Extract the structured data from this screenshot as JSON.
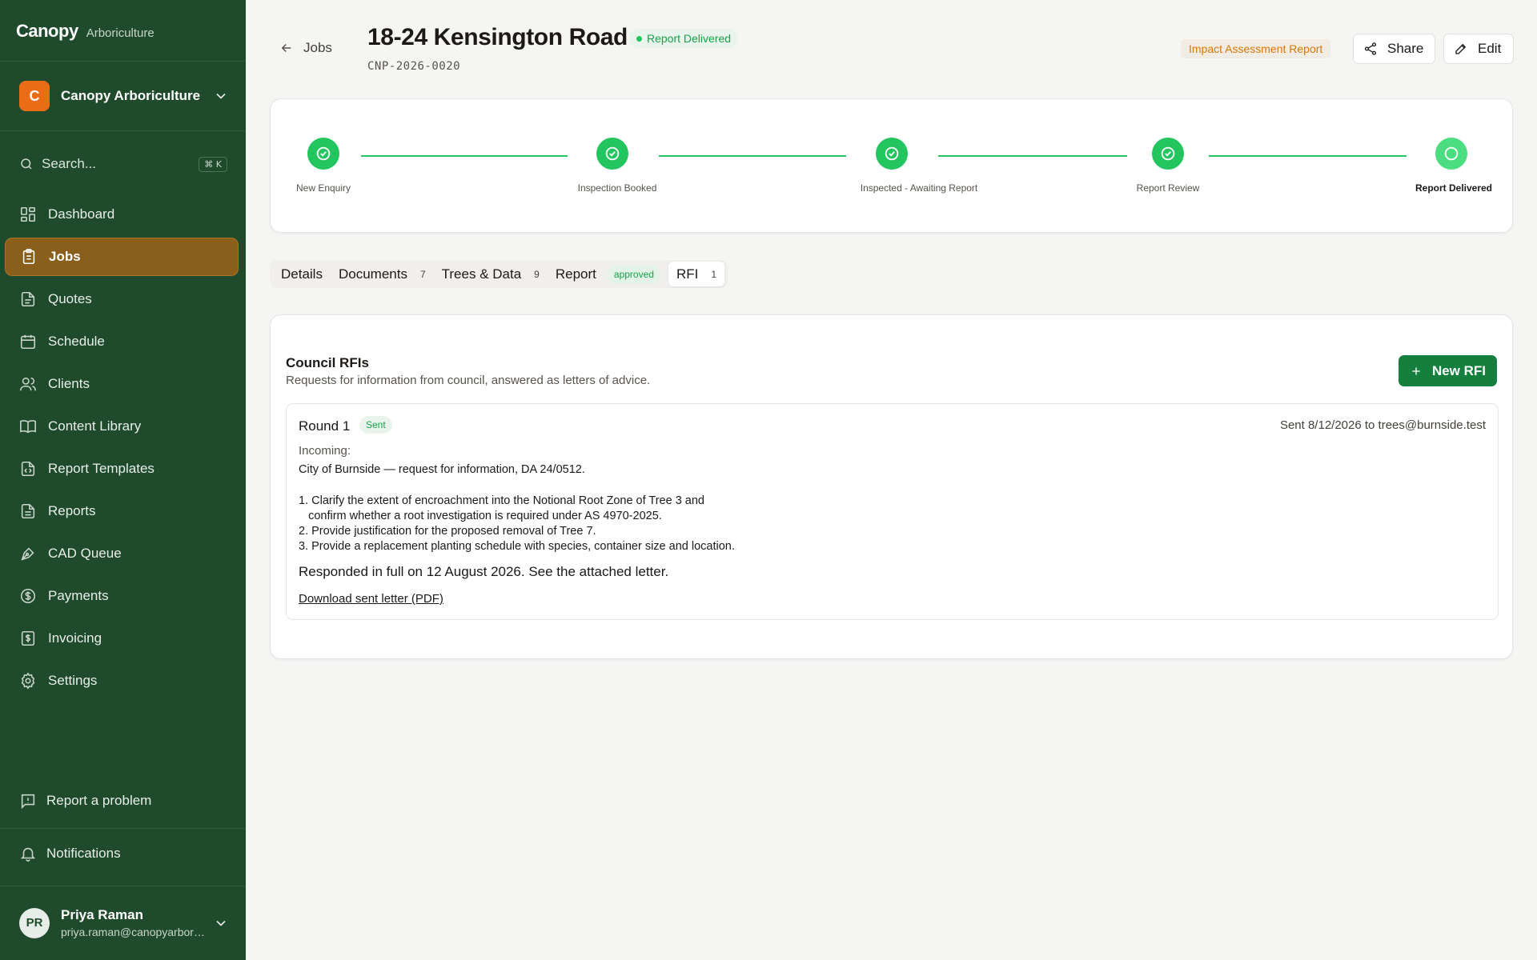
{
  "brand": {
    "name": "Canopy",
    "sub": "Arboriculture"
  },
  "org": {
    "initial": "C",
    "name": "Canopy Arboriculture"
  },
  "search": {
    "placeholder": "Search...",
    "shortcut": "⌘ K"
  },
  "nav": {
    "items": [
      {
        "label": "Dashboard",
        "icon": "dashboard-icon"
      },
      {
        "label": "Jobs",
        "icon": "clipboard-icon",
        "active": true
      },
      {
        "label": "Quotes",
        "icon": "document-icon"
      },
      {
        "label": "Schedule",
        "icon": "calendar-icon"
      },
      {
        "label": "Clients",
        "icon": "users-icon"
      },
      {
        "label": "Content Library",
        "icon": "book-icon"
      },
      {
        "label": "Report Templates",
        "icon": "code-file-icon"
      },
      {
        "label": "Reports",
        "icon": "report-icon"
      },
      {
        "label": "CAD Queue",
        "icon": "pen-tool-icon"
      },
      {
        "label": "Payments",
        "icon": "dollar-circle-icon"
      },
      {
        "label": "Invoicing",
        "icon": "invoice-icon"
      },
      {
        "label": "Settings",
        "icon": "gear-icon"
      }
    ],
    "report_problem": "Report a problem",
    "notifications": "Notifications"
  },
  "user": {
    "initials": "PR",
    "name": "Priya Raman",
    "email": "priya.raman@canopyarboriculture.com"
  },
  "header": {
    "back_label": "Jobs",
    "title": "18-24 Kensington Road",
    "status": "Report Delivered",
    "job_code": "CNP-2026-0020",
    "report_type": "Impact Assessment Report",
    "share_label": "Share",
    "edit_label": "Edit"
  },
  "progress": {
    "steps": [
      {
        "label": "New Enquiry",
        "state": "done"
      },
      {
        "label": "Inspection Booked",
        "state": "done"
      },
      {
        "label": "Inspected - Awaiting Report",
        "state": "done"
      },
      {
        "label": "Report Review",
        "state": "done"
      },
      {
        "label": "Report Delivered",
        "state": "current"
      }
    ]
  },
  "tabs": [
    {
      "label": "Details"
    },
    {
      "label": "Documents",
      "count": "7"
    },
    {
      "label": "Trees & Data",
      "count": "9"
    },
    {
      "label": "Report",
      "badge": "approved"
    },
    {
      "label": "RFI",
      "count": "1",
      "active": true
    }
  ],
  "rfi": {
    "title": "Council RFIs",
    "subtitle": "Requests for information from council, answered as letters of advice.",
    "new_button": "New RFI",
    "round": {
      "title": "Round 1",
      "badge": "Sent",
      "sent_info": "Sent 8/12/2026 to trees@burnside.test",
      "incoming_label": "Incoming:",
      "incoming_text": "City of Burnside — request for information, DA 24/0512.\n\n1. Clarify the extent of encroachment into the Notional Root Zone of Tree 3 and\n   confirm whether a root investigation is required under AS 4970-2025.\n2. Provide justification for the proposed removal of Tree 7.\n3. Provide a replacement planting schedule with species, container size and location.",
      "response": "Responded in full on 12 August 2026. See the attached letter.",
      "download_label": "Download sent letter (PDF)"
    }
  },
  "colors": {
    "sidebar": "#1f4a2c",
    "active_nav": "#8a5f1b",
    "accent_green": "#22c55e",
    "primary_button": "#15803d",
    "warning": "#d97706"
  }
}
